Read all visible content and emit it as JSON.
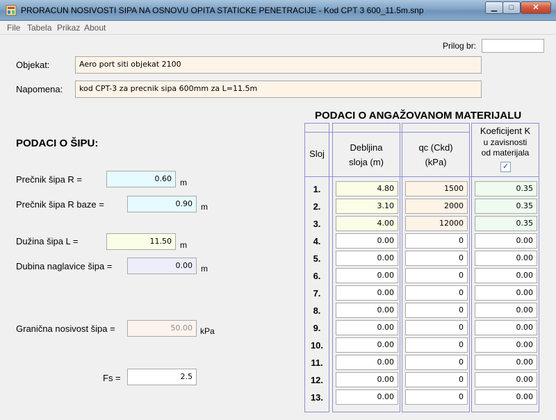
{
  "window": {
    "title": "PRORACUN NOSIVOSTI SIPA NA OSNOVU OPITA STATICKE PENETRACIJE - Kod CPT 3 600_11.5m.snp",
    "minimize_glyph": "▁",
    "maximize_glyph": "□",
    "close_glyph": "✕"
  },
  "menu": [
    "File",
    "Tabela",
    "Prikaz",
    "About"
  ],
  "prilog": {
    "label": "Prilog br:",
    "value": ""
  },
  "objekat": {
    "label": "Objekat:",
    "value": "Aero port siti objekat 2100"
  },
  "napomena": {
    "label": "Napomena:",
    "value": "kod CPT-3 za precnik sipa 600mm za L=11.5m"
  },
  "sip": {
    "heading": "PODACI O ŠIPU:",
    "precnik": {
      "label": "Prečnik šipa R =",
      "value": "0.60",
      "unit": "m"
    },
    "precnik_baze": {
      "label": "Prečnik šipa R baze =",
      "value": "0.90",
      "unit": "m"
    },
    "duzina": {
      "label": "Dužina šipa  L =",
      "value": "11.50",
      "unit": "m"
    },
    "dubina": {
      "label": "Dubina naglavice šipa =",
      "value": "0.00",
      "unit": "m"
    },
    "granicna": {
      "label": "Granična nosivost šipa =",
      "value": "50.00",
      "unit": "kPa"
    },
    "fs": {
      "label": "Fs =",
      "value": "2.5"
    }
  },
  "materijal": {
    "heading": "PODACI O ANGAŽOVANOM MATERIJALU",
    "col_sloj": "Sloj",
    "col_debljina": [
      "Debljina",
      "sloja (m)"
    ],
    "col_qc": [
      "qc (Ckd)",
      "(kPa)"
    ],
    "col_k": [
      "Koeficijent K",
      "u zavisnosti",
      "od materijala"
    ],
    "k_checkbox": "✓",
    "rows": [
      {
        "num": "1.",
        "debljina": "4.80",
        "qc": "1500",
        "k": "0.35"
      },
      {
        "num": "2.",
        "debljina": "3.10",
        "qc": "2000",
        "k": "0.35"
      },
      {
        "num": "3.",
        "debljina": "4.00",
        "qc": "12000",
        "k": "0.35"
      },
      {
        "num": "4.",
        "debljina": "0.00",
        "qc": "0",
        "k": "0.00"
      },
      {
        "num": "5.",
        "debljina": "0.00",
        "qc": "0",
        "k": "0.00"
      },
      {
        "num": "6.",
        "debljina": "0.00",
        "qc": "0",
        "k": "0.00"
      },
      {
        "num": "7.",
        "debljina": "0.00",
        "qc": "0",
        "k": "0.00"
      },
      {
        "num": "8.",
        "debljina": "0.00",
        "qc": "0",
        "k": "0.00"
      },
      {
        "num": "9.",
        "debljina": "0.00",
        "qc": "0",
        "k": "0.00"
      },
      {
        "num": "10.",
        "debljina": "0.00",
        "qc": "0",
        "k": "0.00"
      },
      {
        "num": "11.",
        "debljina": "0.00",
        "qc": "0",
        "k": "0.00"
      },
      {
        "num": "12.",
        "debljina": "0.00",
        "qc": "0",
        "k": "0.00"
      },
      {
        "num": "13.",
        "debljina": "0.00",
        "qc": "0",
        "k": "0.00"
      }
    ]
  }
}
